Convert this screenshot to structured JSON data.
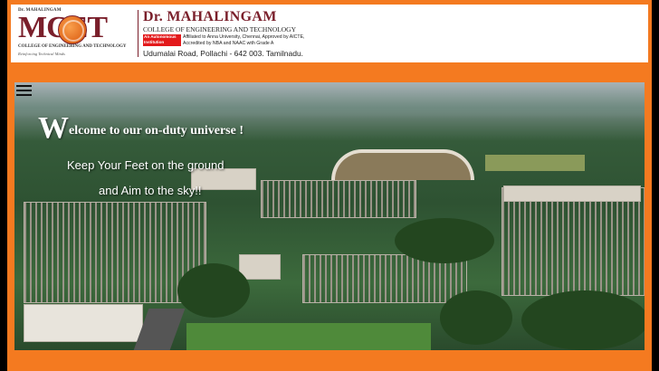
{
  "header": {
    "logo_dr": "Dr. MAHALINGAM",
    "logo_abbr": "MCET",
    "logo_college": "COLLEGE OF ENGINEERING AND TECHNOLOGY",
    "logo_tagline": "Reinforcing Technical Minds",
    "title": "Dr. MAHALINGAM",
    "college": "COLLEGE OF ENGINEERING AND TECHNOLOGY",
    "badge": "An Autonomous Institution",
    "affiliation_1": "Affiliated to Anna University, Chennai, Approved by AICTE,",
    "affiliation_2": "Accredited by NBA  and NAAC with Grade A",
    "address": "Udumalai Road, Pollachi - 642 003. Tamilnadu."
  },
  "hero": {
    "welcome_first": "W",
    "welcome_rest": "elcome to our on-duty universe !",
    "line1": "Keep Your Feet on the ground",
    "line2": "and Aim to the sky!!"
  },
  "colors": {
    "frame": "#f47a20",
    "brand": "#7a1f2b",
    "badge": "#e3191b"
  },
  "icons": {
    "menu": "hamburger-menu-icon"
  }
}
